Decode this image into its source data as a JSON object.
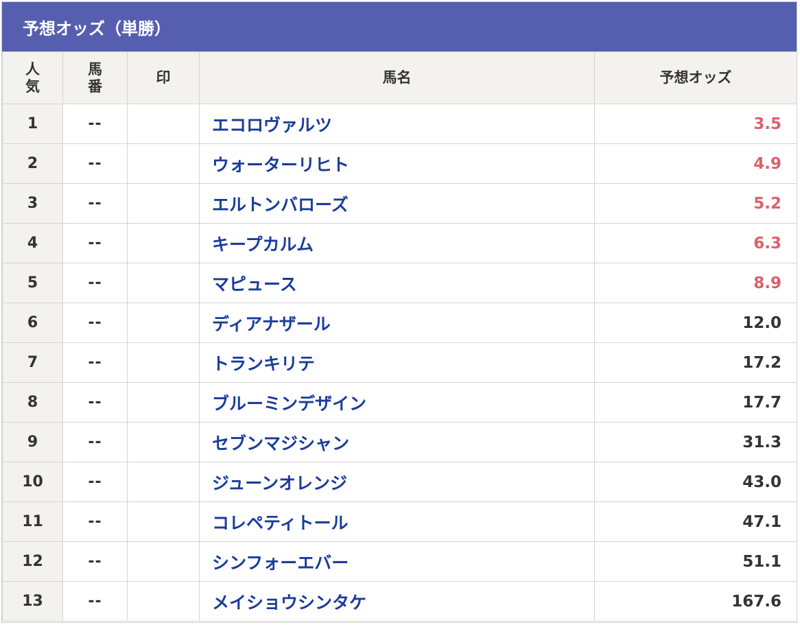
{
  "title": "予想オッズ（単勝）",
  "columns": {
    "rank": [
      "人",
      "気"
    ],
    "number": [
      "馬",
      "番"
    ],
    "mark": "印",
    "name": "馬名",
    "odds": "予想オッズ"
  },
  "rows": [
    {
      "rank": "1",
      "number": "--",
      "mark": "",
      "name": "エコロヴァルツ",
      "odds": "3.5",
      "hot": true
    },
    {
      "rank": "2",
      "number": "--",
      "mark": "",
      "name": "ウォーターリヒト",
      "odds": "4.9",
      "hot": true
    },
    {
      "rank": "3",
      "number": "--",
      "mark": "",
      "name": "エルトンバローズ",
      "odds": "5.2",
      "hot": true
    },
    {
      "rank": "4",
      "number": "--",
      "mark": "",
      "name": "キープカルム",
      "odds": "6.3",
      "hot": true
    },
    {
      "rank": "5",
      "number": "--",
      "mark": "",
      "name": "マピュース",
      "odds": "8.9",
      "hot": true
    },
    {
      "rank": "6",
      "number": "--",
      "mark": "",
      "name": "ディアナザール",
      "odds": "12.0",
      "hot": false
    },
    {
      "rank": "7",
      "number": "--",
      "mark": "",
      "name": "トランキリテ",
      "odds": "17.2",
      "hot": false
    },
    {
      "rank": "8",
      "number": "--",
      "mark": "",
      "name": "ブルーミンデザイン",
      "odds": "17.7",
      "hot": false
    },
    {
      "rank": "9",
      "number": "--",
      "mark": "",
      "name": "セブンマジシャン",
      "odds": "31.3",
      "hot": false
    },
    {
      "rank": "10",
      "number": "--",
      "mark": "",
      "name": "ジューンオレンジ",
      "odds": "43.0",
      "hot": false
    },
    {
      "rank": "11",
      "number": "--",
      "mark": "",
      "name": "コレペティトール",
      "odds": "47.1",
      "hot": false
    },
    {
      "rank": "12",
      "number": "--",
      "mark": "",
      "name": "シンフォーエバー",
      "odds": "51.1",
      "hot": false
    },
    {
      "rank": "13",
      "number": "--",
      "mark": "",
      "name": "メイショウシンタケ",
      "odds": "167.6",
      "hot": false
    }
  ],
  "colors": {
    "header_bg": "#565faf",
    "name_link": "#1a3c9a",
    "hot_odds": "#d9626a",
    "normal_odds": "#333333",
    "cell_bg": "#f3f2ee"
  }
}
